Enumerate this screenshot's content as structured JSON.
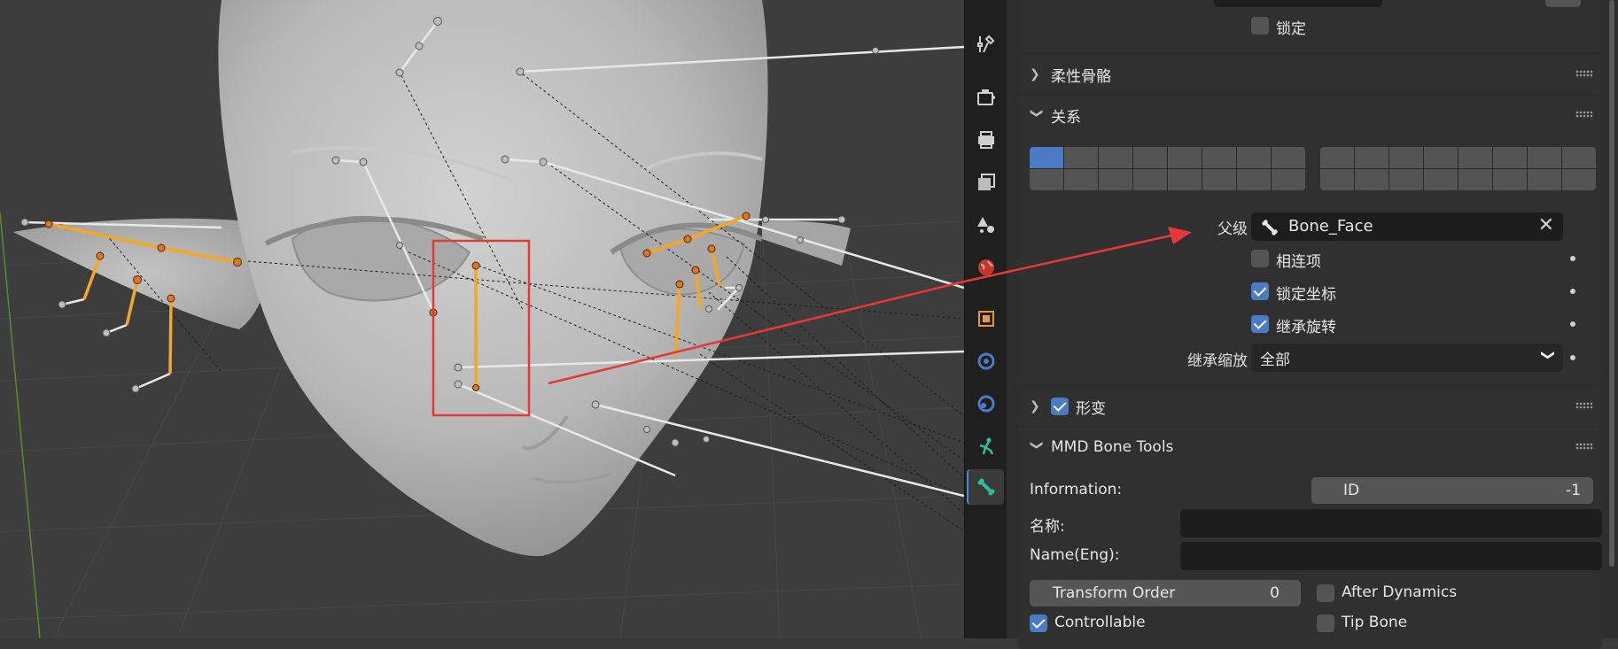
{
  "top_bar": {
    "lock_label": "锁定"
  },
  "panels": {
    "flex_bone": {
      "title": "柔性骨骼",
      "expanded": false
    },
    "relations": {
      "title": "关系",
      "expanded": true,
      "layers_left": [
        1,
        0,
        0,
        0,
        0,
        0,
        0,
        0,
        0,
        0,
        0,
        0,
        0,
        0,
        0,
        0
      ],
      "layers_right": [
        0,
        0,
        0,
        0,
        0,
        0,
        0,
        0,
        0,
        0,
        0,
        0,
        0,
        0,
        0,
        0
      ],
      "parent_label": "父级",
      "parent_value": "Bone_Face",
      "connected_label": "相连项",
      "connected_checked": false,
      "local_location_label": "锁定坐标",
      "local_location_checked": true,
      "inherit_rotation_label": "继承旋转",
      "inherit_rotation_checked": true,
      "inherit_scale_label": "继承缩放",
      "inherit_scale_value": "全部"
    },
    "deform": {
      "title": "形变",
      "checked": true,
      "expanded": false
    },
    "mmd_bone_tools": {
      "title": "MMD Bone Tools",
      "expanded": true,
      "information_label": "Information:",
      "id_label": "ID",
      "id_value": "-1",
      "name_label": "名称:",
      "name_value": "",
      "name_eng_label": "Name(Eng):",
      "name_eng_value": "",
      "transform_order_label": "Transform Order",
      "transform_order_value": "0",
      "after_dynamics_label": "After Dynamics",
      "after_dynamics_checked": false,
      "controllable_label": "Controllable",
      "controllable_checked": true,
      "tip_bone_label": "Tip Bone",
      "tip_bone_checked": false
    }
  },
  "tabs": [
    {
      "icon": "tool-icon"
    },
    {
      "icon": "render-icon"
    },
    {
      "icon": "output-icon"
    },
    {
      "icon": "view-layer-icon"
    },
    {
      "icon": "scene-icon"
    },
    {
      "icon": "world-icon"
    },
    {
      "icon": "object-icon"
    },
    {
      "icon": "modifier-icon"
    },
    {
      "icon": "physics-icon"
    },
    {
      "icon": "armature-data-icon"
    },
    {
      "icon": "bone-icon",
      "active": true
    }
  ],
  "colors": {
    "accent": "#4a7bc4",
    "bone_selected": "#f5a623",
    "annotation": "#e53935",
    "active_tab_icon": "#2fbfa0"
  }
}
